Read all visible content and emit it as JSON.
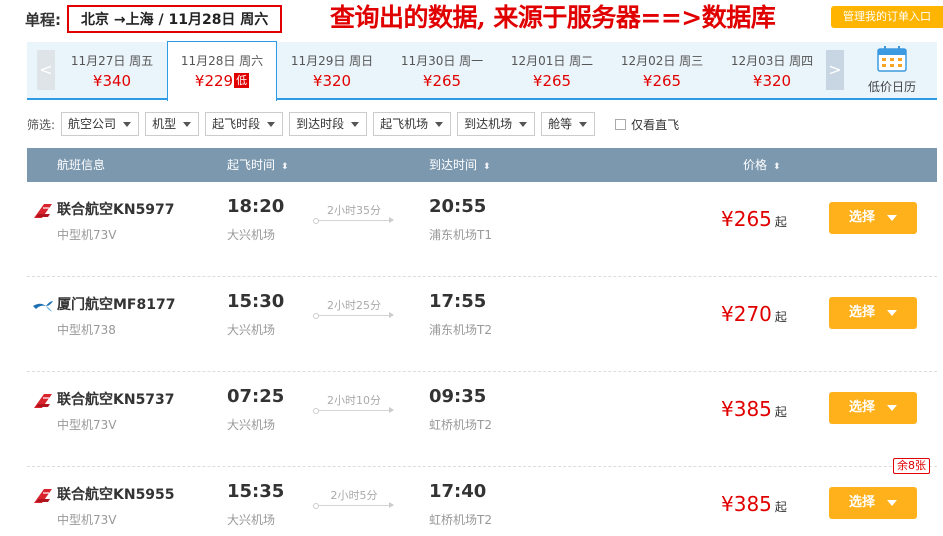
{
  "route": {
    "label": "单程:",
    "text": "北京 →上海  /  11月28日 周六"
  },
  "annotation": "查询出的数据, 来源于服务器==>数据库",
  "manage_button": "管理我的订单入口",
  "dates": [
    {
      "date": "11月27日 周五",
      "price": "¥340",
      "active": false
    },
    {
      "date": "11月28日 周六",
      "price": "¥229",
      "active": true,
      "tag": "低"
    },
    {
      "date": "11月29日 周日",
      "price": "¥320",
      "active": false
    },
    {
      "date": "11月30日 周一",
      "price": "¥265",
      "active": false
    },
    {
      "date": "12月01日 周二",
      "price": "¥265",
      "active": false
    },
    {
      "date": "12月02日 周三",
      "price": "¥265",
      "active": false
    },
    {
      "date": "12月03日 周四",
      "price": "¥320",
      "active": false
    }
  ],
  "prev_arrow": "<",
  "next_arrow": ">",
  "calendar_label": "低价日历",
  "filters": {
    "label": "筛选:",
    "items": [
      "航空公司",
      "机型",
      "起飞时段",
      "到达时段",
      "起飞机场",
      "到达机场",
      "舱等"
    ],
    "direct_only": "仅看直飞"
  },
  "table_header": {
    "flight": "航班信息",
    "depart": "起飞时间",
    "arrive": "到达时间",
    "price": "价格",
    "sort_glyph": "⬍"
  },
  "flights": [
    {
      "airline": "联合航空KN5977",
      "plane": "中型机73V",
      "dep_time": "18:20",
      "dep_airport": "大兴机场",
      "duration": "2小时35分",
      "arr_time": "20:55",
      "arr_airport": "浦东机场T1",
      "price": "¥265",
      "qi": "起",
      "button": "选择",
      "logo": "china-united-logo",
      "remaining": ""
    },
    {
      "airline": "厦门航空MF8177",
      "plane": "中型机738",
      "dep_time": "15:30",
      "dep_airport": "大兴机场",
      "duration": "2小时25分",
      "arr_time": "17:55",
      "arr_airport": "浦东机场T2",
      "price": "¥270",
      "qi": "起",
      "button": "选择",
      "logo": "xiamen-air-logo",
      "remaining": ""
    },
    {
      "airline": "联合航空KN5737",
      "plane": "中型机73V",
      "dep_time": "07:25",
      "dep_airport": "大兴机场",
      "duration": "2小时10分",
      "arr_time": "09:35",
      "arr_airport": "虹桥机场T2",
      "price": "¥385",
      "qi": "起",
      "button": "选择",
      "logo": "china-united-logo",
      "remaining": ""
    },
    {
      "airline": "联合航空KN5955",
      "plane": "中型机73V",
      "dep_time": "15:35",
      "dep_airport": "大兴机场",
      "duration": "2小时5分",
      "arr_time": "17:40",
      "arr_airport": "虹桥机场T2",
      "price": "¥385",
      "qi": "起",
      "button": "选择",
      "logo": "china-united-logo",
      "remaining": "余8张"
    }
  ],
  "colors": {
    "accent": "#2e9be6",
    "price": "#e10000",
    "button": "#ffb11b",
    "header": "#7c98ae"
  }
}
